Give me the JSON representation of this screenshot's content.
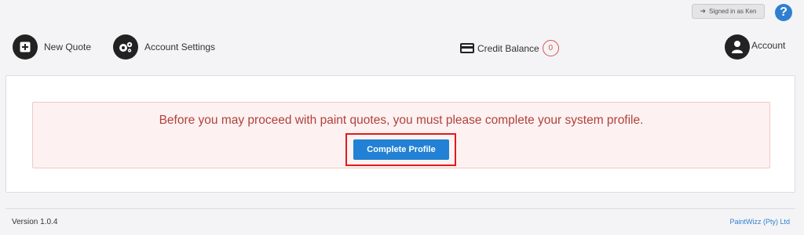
{
  "topbar": {
    "signed_in_label": "Signed in as Ken",
    "help_glyph": "?"
  },
  "nav": {
    "new_quote": "New Quote",
    "account_settings": "Account Settings",
    "credit_balance_label": "Credit Balance",
    "credit_balance_value": "0",
    "account": "Account"
  },
  "alert": {
    "message": "Before you may proceed with paint quotes, you must please complete your system profile.",
    "button_label": "Complete Profile"
  },
  "footer": {
    "version": "Version 1.0.4",
    "company": "PaintWizz (Pty) Ltd"
  },
  "colors": {
    "primary": "#2281d4",
    "danger": "#b0413d",
    "highlight": "#e01b1b"
  }
}
